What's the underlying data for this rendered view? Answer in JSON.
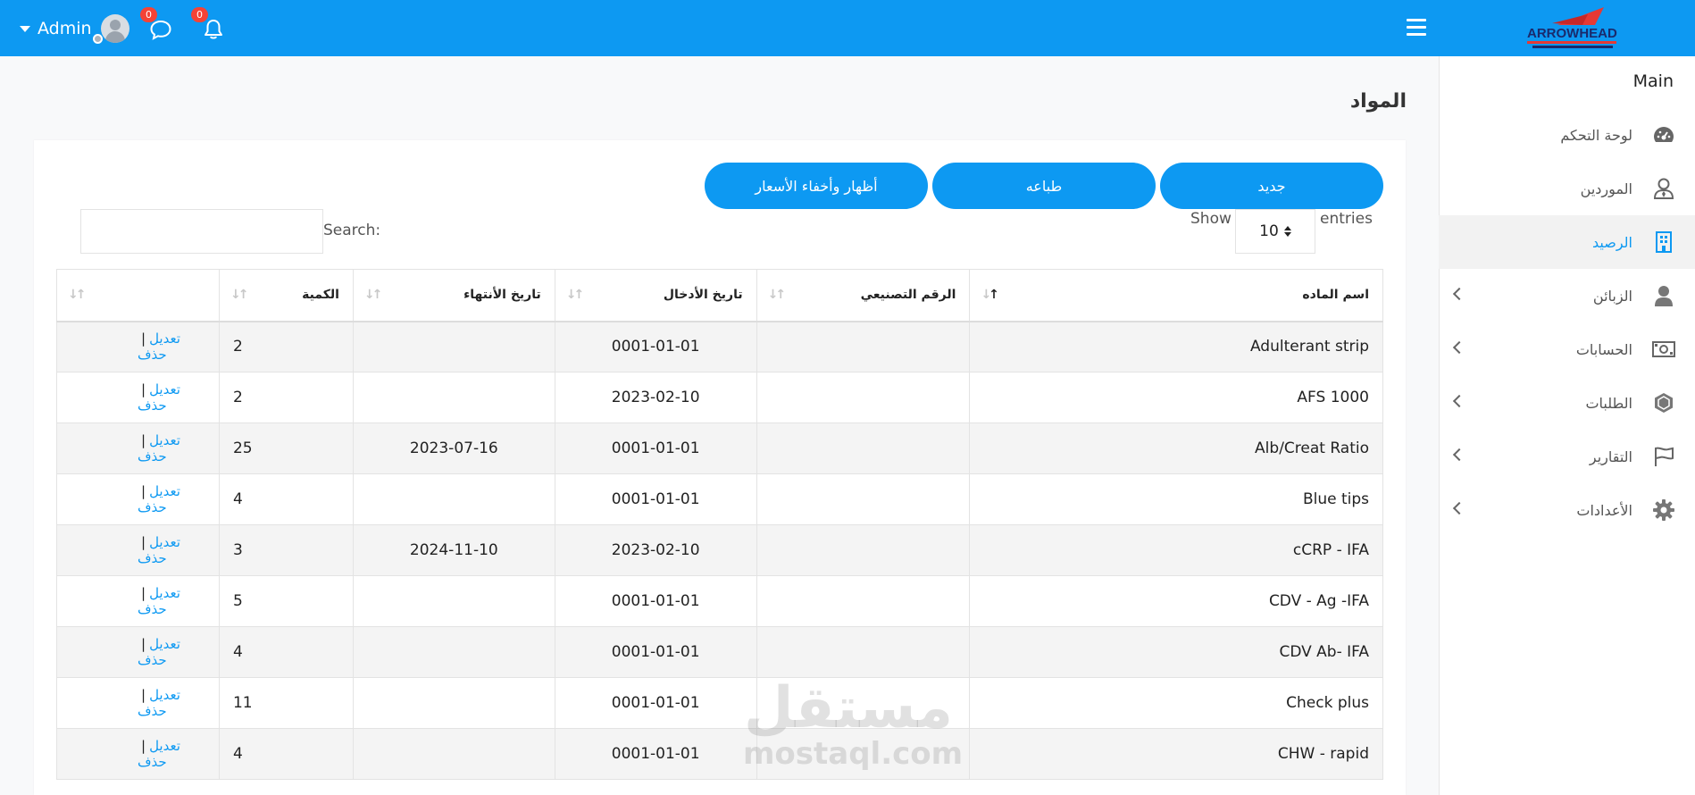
{
  "header": {
    "user_name": "Admin",
    "messages_count": "0",
    "notifications_count": "0",
    "brand": "ARROWHEAD"
  },
  "sidebar": {
    "section": "Main",
    "items": [
      {
        "label": "لوحة التحكم",
        "icon": "dashboard-gauge-icon"
      },
      {
        "label": "الموردين",
        "icon": "user-tie-icon"
      },
      {
        "label": "الرصيد",
        "icon": "building-icon",
        "active": true
      },
      {
        "label": "الزبائن",
        "icon": "user-icon"
      },
      {
        "label": "الحسابات",
        "icon": "money-bill-icon"
      },
      {
        "label": "الطلبات",
        "icon": "hexagon-box-icon"
      },
      {
        "label": "التقارير",
        "icon": "flag-icon"
      },
      {
        "label": "الأعدادات",
        "icon": "gear-icon"
      }
    ]
  },
  "page": {
    "title": "المواد"
  },
  "toolbar": {
    "new_label": "جديد",
    "print_label": "طباعه",
    "toggle_prices_label": "أظهار وأخفاء الأسعار"
  },
  "datatable": {
    "show_label": "Show",
    "entries_label": "entries",
    "page_length": "10",
    "search_label": "Search:",
    "search_value": "",
    "columns": [
      "اسم الماده",
      "الرقم التصنيعي",
      "تاريخ الأدخال",
      "تاريخ الأنتهاء",
      "الكمية",
      ""
    ],
    "edit_label": "تعديل",
    "delete_label": "حذف",
    "rows": [
      {
        "name": "Adulterant strip",
        "serial": "",
        "entry_date": "0001-01-01",
        "expiry_date": "",
        "qty": "2"
      },
      {
        "name": "AFS 1000",
        "serial": "",
        "entry_date": "2023-02-10",
        "expiry_date": "",
        "qty": "2"
      },
      {
        "name": "Alb/Creat Ratio",
        "serial": "",
        "entry_date": "0001-01-01",
        "expiry_date": "2023-07-16",
        "qty": "25"
      },
      {
        "name": "Blue tips",
        "serial": "",
        "entry_date": "0001-01-01",
        "expiry_date": "",
        "qty": "4"
      },
      {
        "name": "cCRP - IFA",
        "serial": "",
        "entry_date": "2023-02-10",
        "expiry_date": "2024-11-10",
        "qty": "3"
      },
      {
        "name": "CDV - Ag -IFA",
        "serial": "",
        "entry_date": "0001-01-01",
        "expiry_date": "",
        "qty": "5"
      },
      {
        "name": "CDV Ab- IFA",
        "serial": "",
        "entry_date": "0001-01-01",
        "expiry_date": "",
        "qty": "4"
      },
      {
        "name": "Check plus",
        "serial": "",
        "entry_date": "0001-01-01",
        "expiry_date": "",
        "qty": "11"
      },
      {
        "name": "CHW - rapid",
        "serial": "",
        "entry_date": "0001-01-01",
        "expiry_date": "",
        "qty": "4"
      }
    ]
  },
  "watermark": {
    "arabic": "مستقل",
    "latin": "mostaql.com"
  },
  "colors": {
    "primary": "#0d99f2",
    "badge": "#f44336"
  }
}
